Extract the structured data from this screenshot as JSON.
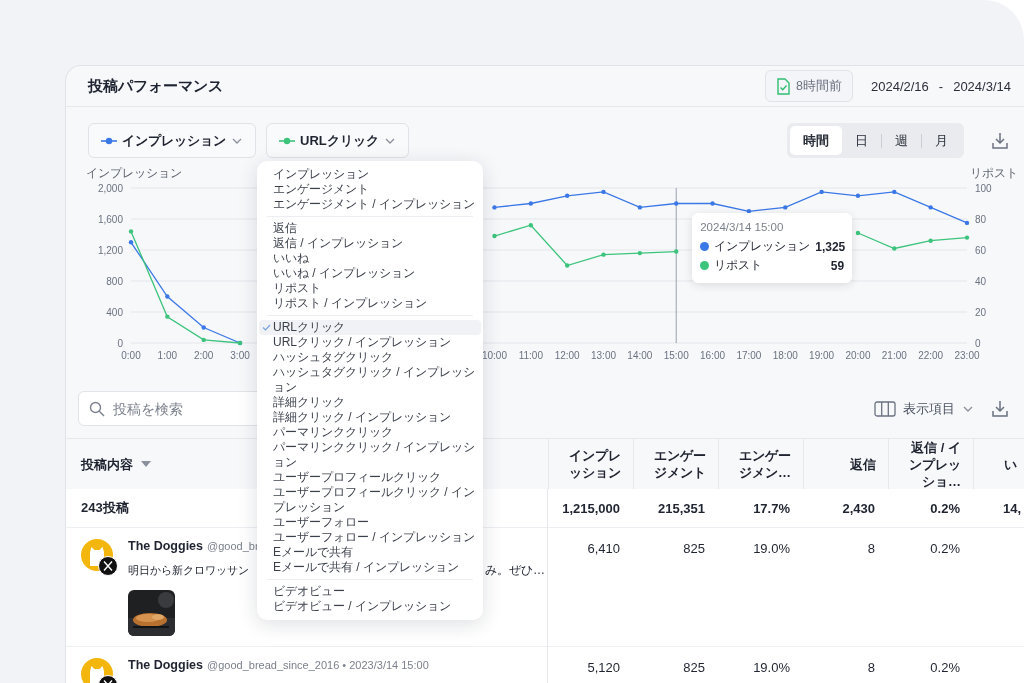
{
  "header": {
    "title": "投稿パフォーマンス",
    "updated": "8時間前",
    "date_start": "2024/2/16",
    "date_sep": "-",
    "date_end": "2024/3/14"
  },
  "metric_selectors": [
    {
      "label": "インプレッション",
      "color": "#3b78e7"
    },
    {
      "label": "URLクリック",
      "color": "#3cc47c",
      "menu": {
        "groups": [
          {
            "items": [
              {
                "label": "インプレッション",
                "selected": false
              },
              {
                "label": "エンゲージメント",
                "selected": false
              },
              {
                "label": "エンゲージメント / インプレッション",
                "selected": false
              }
            ]
          },
          {
            "items": [
              {
                "label": "返信",
                "selected": false
              },
              {
                "label": "返信 / インプレッション",
                "selected": false
              },
              {
                "label": "いいね",
                "selected": false
              },
              {
                "label": "いいね / インプレッション",
                "selected": false
              },
              {
                "label": "リポスト",
                "selected": false
              },
              {
                "label": "リポスト / インプレッション",
                "selected": false
              }
            ]
          },
          {
            "items": [
              {
                "label": "URLクリック",
                "selected": true
              },
              {
                "label": "URLクリック / インプレッション",
                "selected": false
              },
              {
                "label": "ハッシュタグクリック",
                "selected": false
              },
              {
                "label": "ハッシュタグクリック / インプレッション",
                "selected": false
              },
              {
                "label": "詳細クリック",
                "selected": false
              },
              {
                "label": "詳細クリック / インプレッション",
                "selected": false
              },
              {
                "label": "パーマリンククリック",
                "selected": false
              },
              {
                "label": "パーマリンククリック / インプレッション",
                "selected": false
              },
              {
                "label": "ユーザープロフィールクリック",
                "selected": false
              },
              {
                "label": "ユーザープロフィールクリック / インプレッション",
                "selected": false
              },
              {
                "label": "ユーザーフォロー",
                "selected": false
              },
              {
                "label": "ユーザーフォロー / インプレッション",
                "selected": false
              },
              {
                "label": "Eメールで共有",
                "selected": false
              },
              {
                "label": "Eメールで共有 / インプレッション",
                "selected": false
              }
            ]
          },
          {
            "items": [
              {
                "label": "ビデオビュー",
                "selected": false
              },
              {
                "label": "ビデオビュー / インプレッション",
                "selected": false
              }
            ]
          }
        ]
      }
    }
  ],
  "granularity": [
    {
      "label": "時間",
      "selected": true
    },
    {
      "label": "日",
      "selected": false
    },
    {
      "label": "週",
      "selected": false
    },
    {
      "label": "月",
      "selected": false
    }
  ],
  "chart": {
    "chart_data": {
      "type": "line",
      "ylabel": "インプレッション",
      "y2label": "リポスト",
      "grid": true,
      "legend": true,
      "ref_lines": [
        {
          "axis": "x",
          "value": "15:00"
        }
      ],
      "categories": [
        "0:00",
        "1:00",
        "2:00",
        "3:00",
        null,
        null,
        null,
        null,
        null,
        null,
        "10:00",
        "11:00",
        "12:00",
        "13:00",
        "14:00",
        "15:00",
        "16:00",
        "17:00",
        "18:00",
        "19:00",
        "20:00",
        "21:00",
        "22:00",
        "23:00"
      ],
      "series": [
        {
          "name": "インプレッション",
          "color": "#3b78e7",
          "values": [
            1300,
            600,
            200,
            0,
            null,
            null,
            null,
            null,
            null,
            null,
            1750,
            1800,
            1900,
            1950,
            1750,
            1800,
            1800,
            1700,
            1750,
            1950,
            1900,
            1950,
            1750,
            1550
          ]
        },
        {
          "name": "リポスト",
          "color": "#3cc47c",
          "axis": "y2",
          "values": [
            72,
            17,
            2,
            0,
            null,
            null,
            null,
            null,
            null,
            null,
            69,
            76,
            50,
            57,
            58,
            59,
            null,
            null,
            null,
            null,
            71,
            61,
            66,
            68
          ]
        }
      ],
      "ylim": [
        0,
        2000
      ],
      "yticks": [
        {
          "value": 0,
          "label": "0"
        },
        {
          "value": 400,
          "label": "400"
        },
        {
          "value": 800,
          "label": "800"
        },
        {
          "value": 1200,
          "label": "1,200"
        },
        {
          "value": 1600,
          "label": "1,600"
        },
        {
          "value": 2000,
          "label": "2,000"
        }
      ],
      "y2lim": [
        0,
        100
      ],
      "y2ticks": [
        0,
        20,
        40,
        60,
        80,
        100
      ]
    },
    "tooltip": {
      "title": "2024/3/14 15:00",
      "values": [
        "1,325",
        "59"
      ]
    }
  },
  "search": {
    "placeholder": "投稿を検索"
  },
  "columns_button": "表示項目",
  "table": {
    "columns": [
      {
        "label": "投稿内容",
        "sortable": true
      },
      {
        "label": "インプレッション"
      },
      {
        "label": "エンゲージメント"
      },
      {
        "label": "エンゲージメン…"
      },
      {
        "label": "返信"
      },
      {
        "label": "返信 / インプレッショ…"
      },
      {
        "label": "い"
      }
    ],
    "summary": {
      "cells": [
        "243投稿",
        "1,215,000",
        "215,351",
        "17.7%",
        "2,430",
        "0.2%",
        "14,"
      ]
    },
    "rows": [
      {
        "cells": [
          {
            "author": "The Doggies",
            "meta": "@good_br",
            "text_start": "明日から新クロワッサン",
            "text_end": "み。ぜひ…"
          },
          "6,410",
          "825",
          "19.0%",
          "8",
          "0.2%"
        ]
      },
      {
        "cells": [
          {
            "author": "The Doggies",
            "meta": "@good_bread_since_2016 • 2023/3/14 15:00"
          },
          "5,120",
          "825",
          "19.0%",
          "8",
          "0.2%"
        ]
      }
    ]
  }
}
